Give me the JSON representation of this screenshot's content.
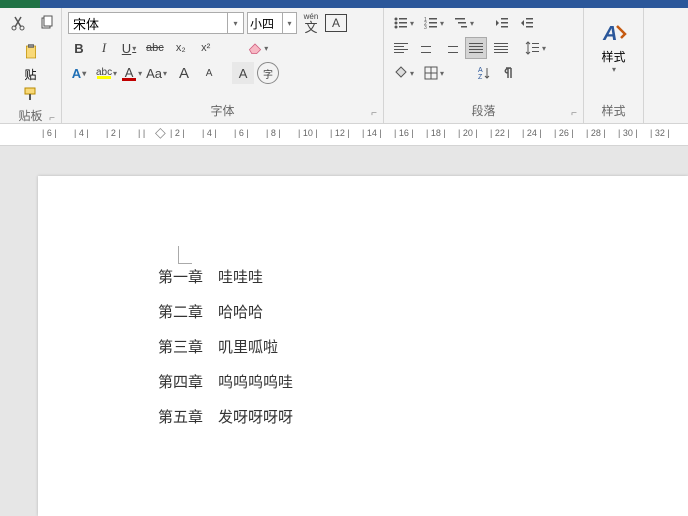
{
  "font": {
    "name": "宋体",
    "size": "小四",
    "wen_label": "wén",
    "wen_char": "文",
    "boxed": "A",
    "bold": "B",
    "italic": "I",
    "underline": "U",
    "strike": "abc",
    "sub": "x₂",
    "sup": "x²",
    "effects": "A",
    "phonetic": "abc",
    "fontcolor": "A",
    "changecase": "Aa",
    "grow": "A",
    "shrink": "A",
    "charshade": "A",
    "circled": "字",
    "group_label": "字体"
  },
  "paragraph": {
    "group_label": "段落"
  },
  "styles": {
    "label": "样式",
    "group_label": "样式"
  },
  "clipboard": {
    "paste": "贴",
    "group_label": "贴板"
  },
  "dialog_launcher": "⌐",
  "ruler": {
    "ticks": [
      "6",
      "4",
      "2",
      "",
      "2",
      "4",
      "6",
      "8",
      "10",
      "12",
      "14",
      "16",
      "18",
      "20",
      "22",
      "24",
      "26",
      "28",
      "30",
      "32"
    ]
  },
  "doc": {
    "lines": [
      {
        "chapter": "第一章",
        "title": "哇哇哇"
      },
      {
        "chapter": "第二章",
        "title": "哈哈哈"
      },
      {
        "chapter": "第三章",
        "title": "叽里呱啦"
      },
      {
        "chapter": "第四章",
        "title": "呜呜呜呜哇"
      },
      {
        "chapter": "第五章",
        "title": "发呀呀呀呀"
      }
    ]
  }
}
